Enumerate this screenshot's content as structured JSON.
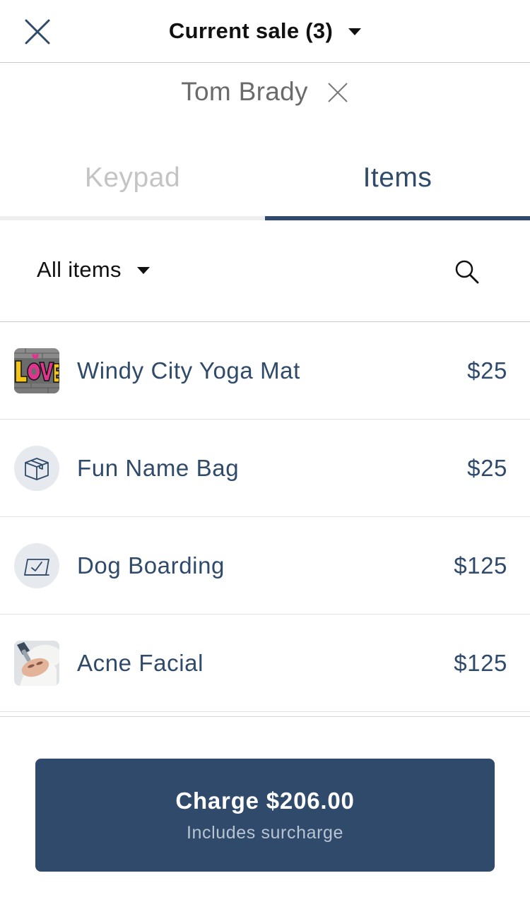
{
  "header": {
    "close_icon": "close-icon",
    "title": "Current sale (3)",
    "title_dropdown_icon": "chevron-down-icon"
  },
  "customer": {
    "name": "Tom Brady",
    "clear_icon": "close-icon"
  },
  "tabs": [
    {
      "label": "Keypad",
      "active": false
    },
    {
      "label": "Items",
      "active": true
    }
  ],
  "filter": {
    "selected": "All items",
    "dropdown_icon": "chevron-down-icon",
    "search_icon": "search-icon"
  },
  "items": [
    {
      "name": "Windy City Yoga Mat",
      "price": "$25",
      "thumb": "graffiti-image"
    },
    {
      "name": "Fun Name Bag",
      "price": "$25",
      "thumb": "box-icon"
    },
    {
      "name": "Dog Boarding",
      "price": "$125",
      "thumb": "service-icon"
    },
    {
      "name": "Acne Facial",
      "price": "$125",
      "thumb": "facial-photo"
    }
  ],
  "charge": {
    "label": "Charge $206.00",
    "sublabel": "Includes surcharge"
  },
  "colors": {
    "primary": "#2f4a6a",
    "inactive_tab": "#c4c4c4",
    "divider": "#c9c9c9"
  }
}
